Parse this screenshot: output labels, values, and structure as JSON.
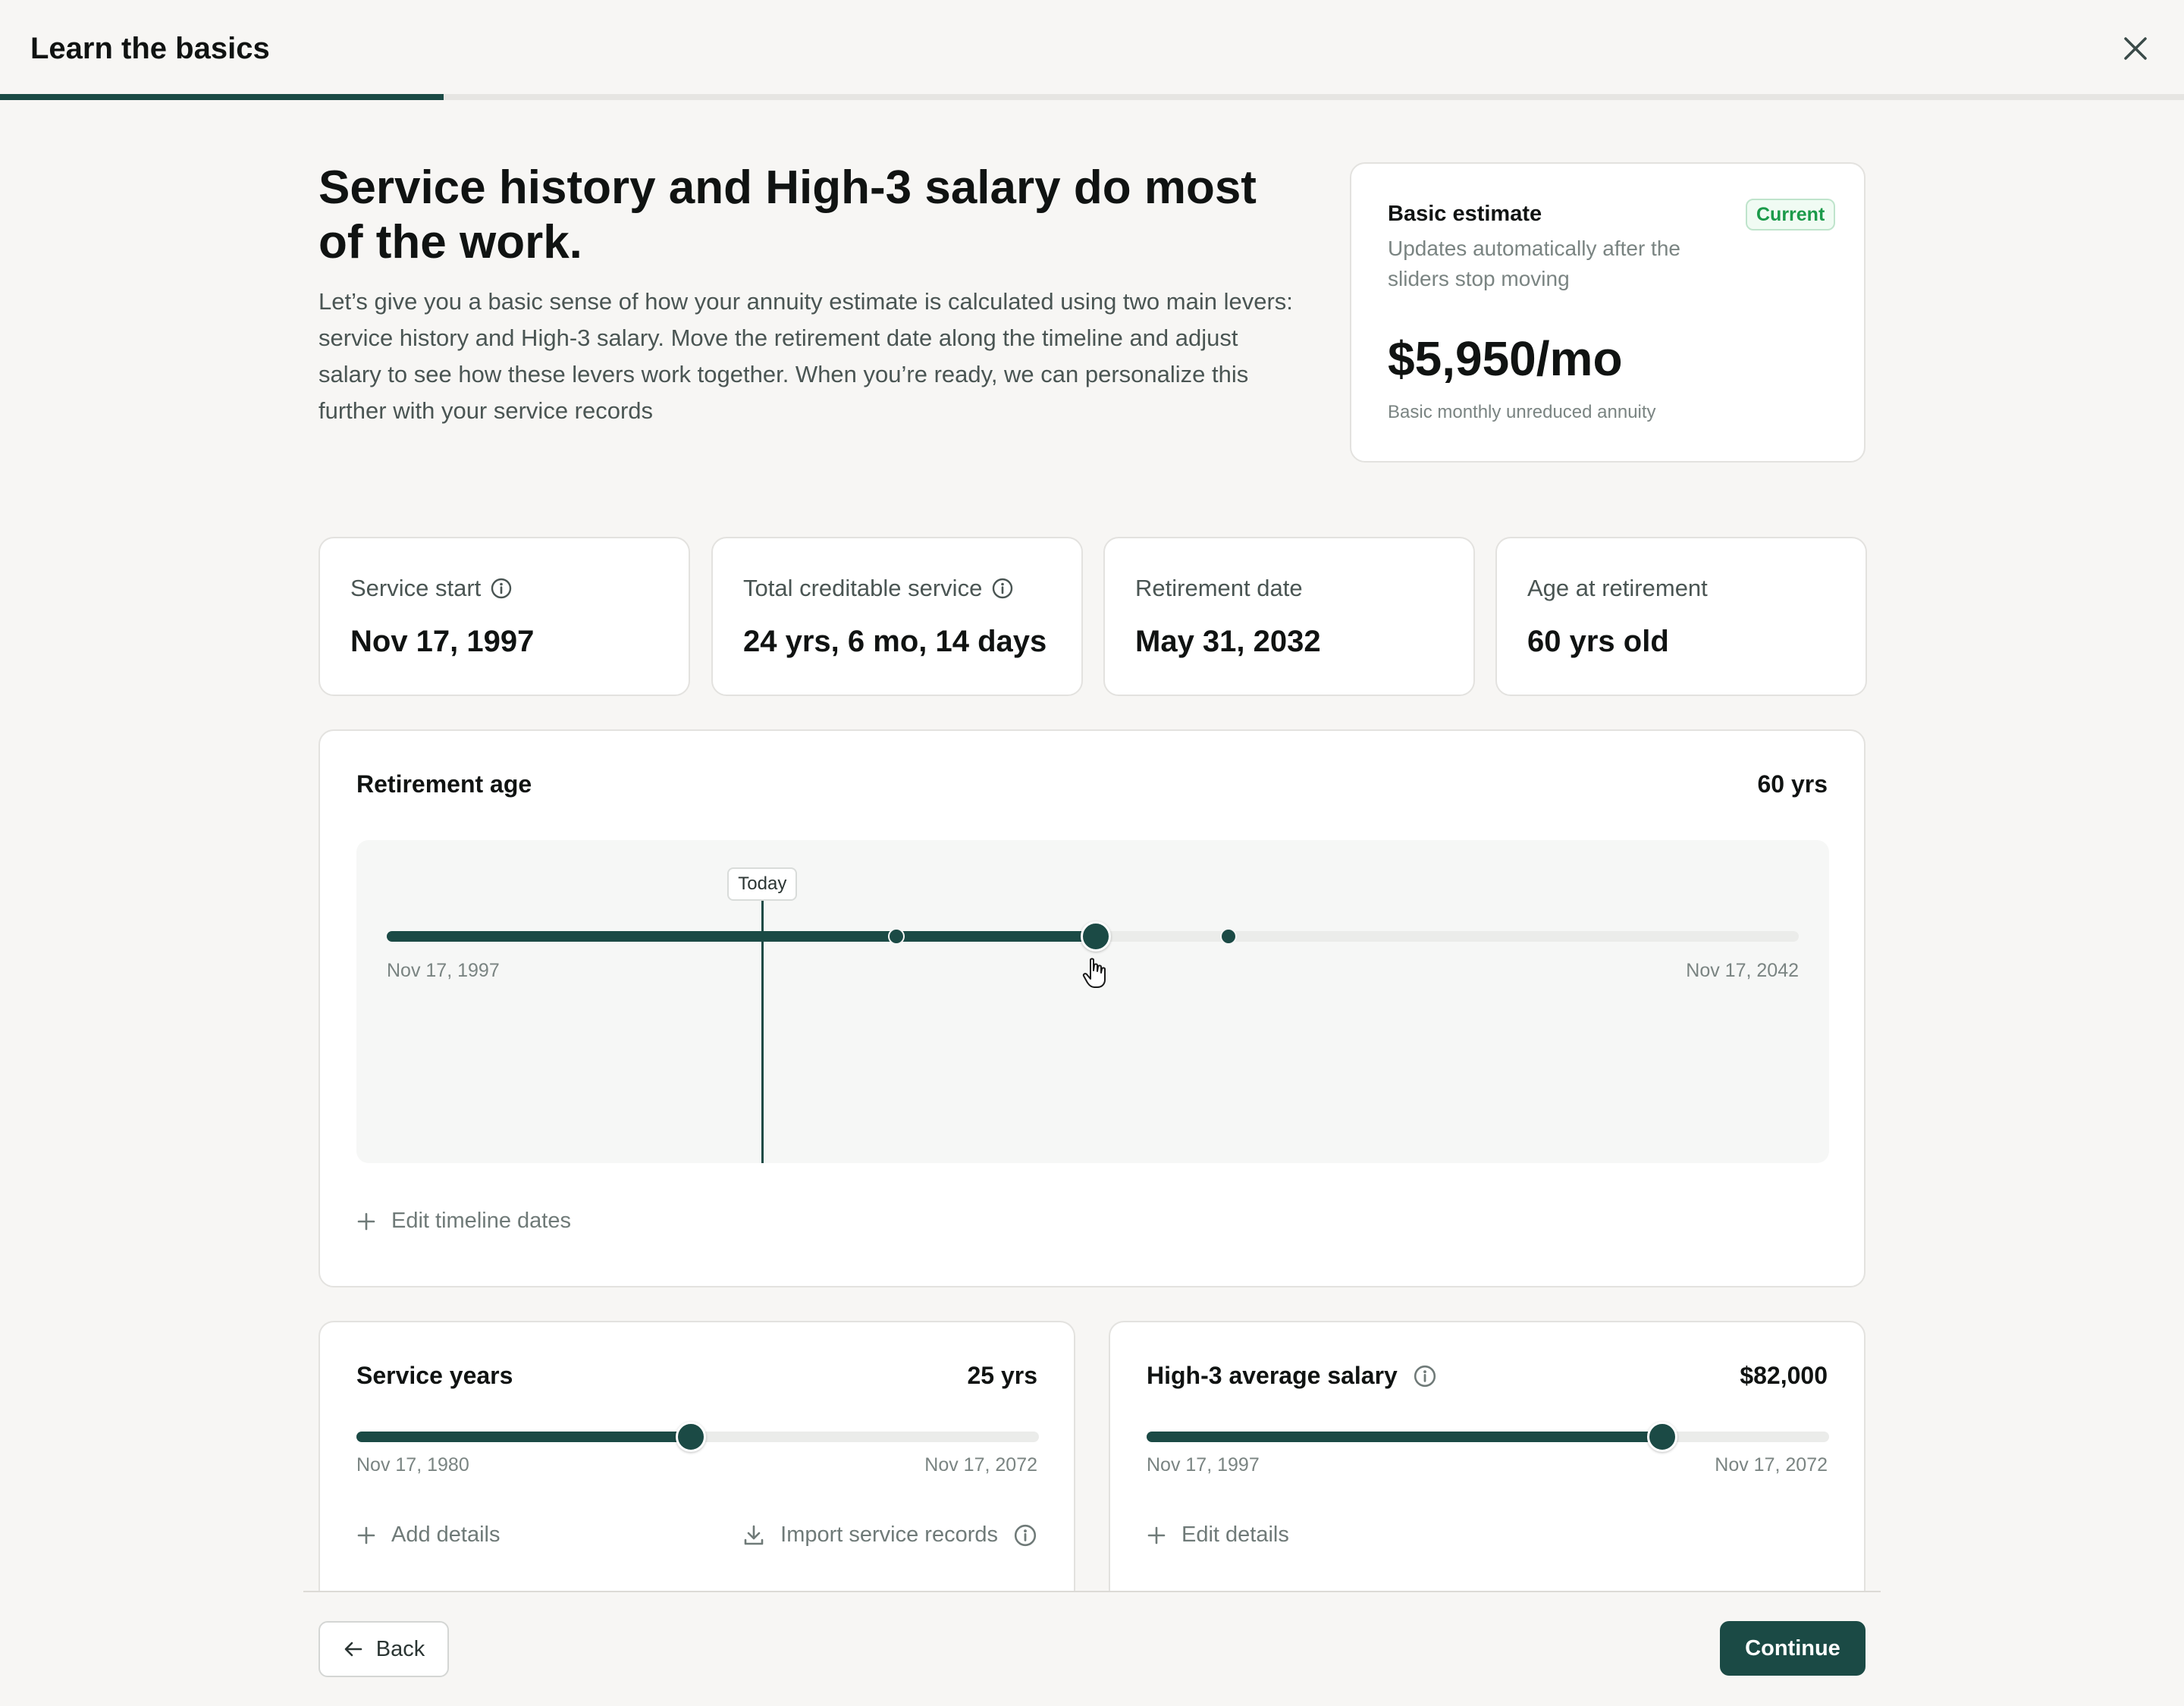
{
  "header": {
    "title": "Learn the basics",
    "progress_percent": 20.3
  },
  "intro": {
    "headline": "Service history and High-3 salary do most of the work.",
    "body": "Let’s give you a basic sense of how your annuity estimate is calculated using two main levers: service history and High-3 salary. Move the retirement date along the timeline and adjust salary to see how these levers work together. When you’re ready, we can personalize this further with your service records"
  },
  "estimate": {
    "title": "Basic estimate",
    "subtitle": "Updates automatically after the sliders stop moving",
    "badge": "Current",
    "amount": "$5,950/mo",
    "note": "Basic monthly unreduced annuity"
  },
  "stats": [
    {
      "label": "Service start",
      "value": "Nov 17, 1997",
      "has_info": true
    },
    {
      "label": "Total creditable service",
      "value": "24 yrs, 6 mo, 14 days",
      "has_info": true
    },
    {
      "label": "Retirement date",
      "value": "May 31, 2032",
      "has_info": false
    },
    {
      "label": "Age at retirement",
      "value": "60 yrs old",
      "has_info": false
    }
  ],
  "retirement": {
    "title": "Retirement age",
    "value": "60 yrs",
    "timeline": {
      "start_label": "Nov 17, 1997",
      "end_label": "Nov 17, 2042",
      "today_label": "Today",
      "today_fraction": 0.266,
      "marker1_fraction": 0.361,
      "thumb_fraction": 0.502,
      "marker2_fraction": 0.596
    },
    "edit_label": "Edit timeline dates"
  },
  "service_years": {
    "title": "Service years",
    "value": "25 yrs",
    "start_label": "Nov 17, 1980",
    "end_label": "Nov 17, 2072",
    "fraction": 0.49,
    "add_label": "Add details",
    "import_label": "Import service records"
  },
  "salary": {
    "title": "High-3 average salary",
    "value": "$82,000",
    "start_label": "Nov 17, 1997",
    "end_label": "Nov 17, 2072",
    "fraction": 0.756,
    "edit_label": "Edit details"
  },
  "footer": {
    "back_label": "Back",
    "continue_label": "Continue"
  },
  "colors": {
    "accent": "#1b4a45",
    "badge_green": "#1b9a4a",
    "background": "#f7f6f4"
  }
}
